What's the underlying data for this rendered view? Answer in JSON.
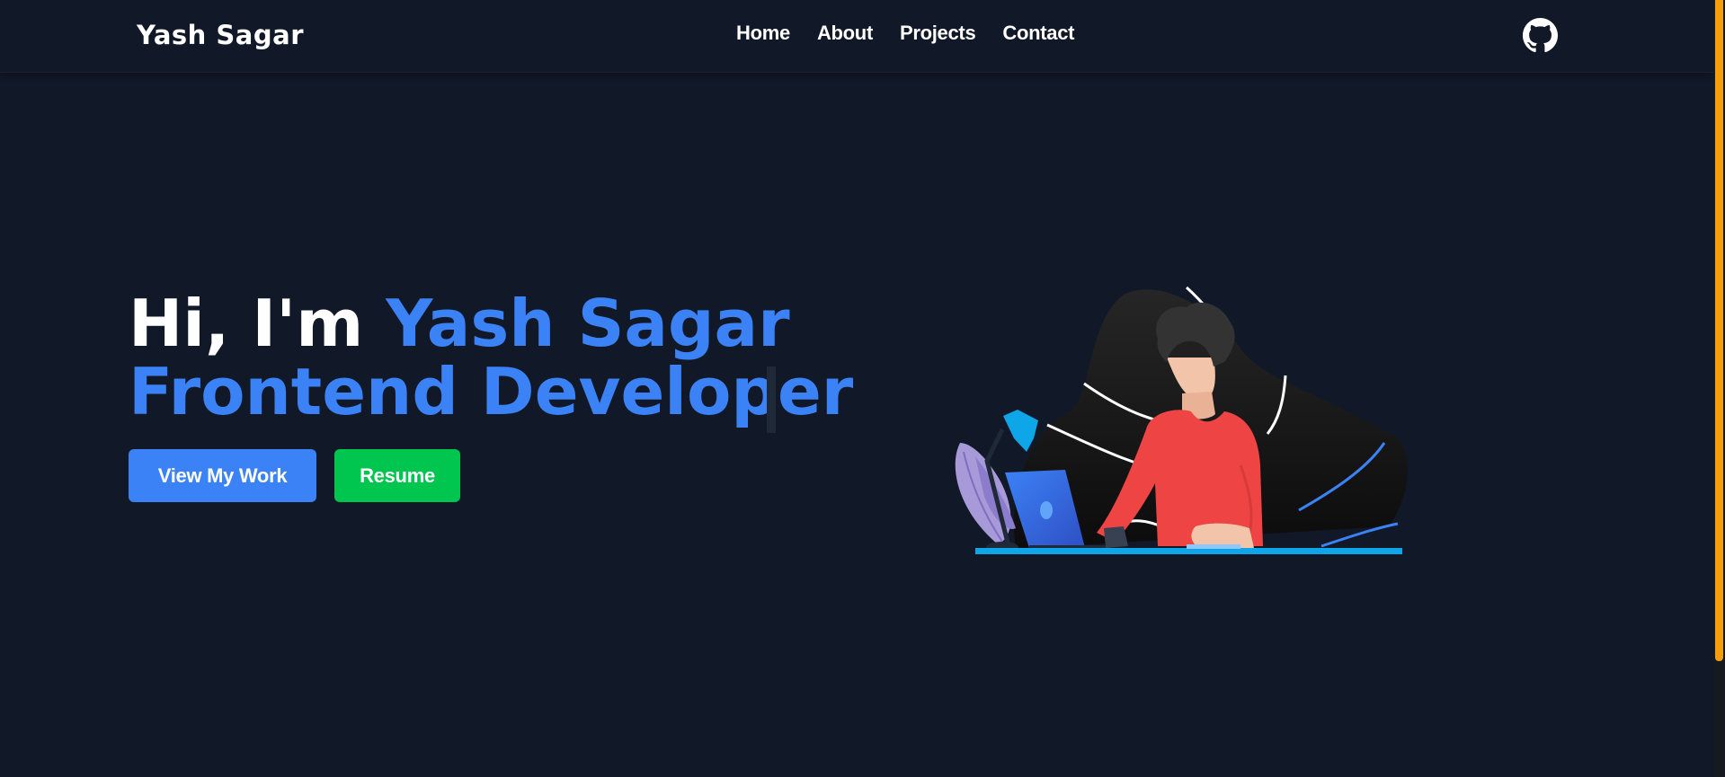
{
  "brand": {
    "name": "Yash Sagar"
  },
  "nav": {
    "links": [
      {
        "label": "Home"
      },
      {
        "label": "About"
      },
      {
        "label": "Projects"
      },
      {
        "label": "Contact"
      }
    ],
    "github_icon": "github-icon"
  },
  "hero": {
    "greeting": "Hi, I'm ",
    "name": "Yash Sagar",
    "role": "Frontend Developer",
    "buttons": {
      "work_label": "View My Work",
      "resume_label": "Resume"
    }
  },
  "colors": {
    "background": "#111827",
    "accent_blue": "#3b82f6",
    "resume_green": "#00c64f",
    "scrollbar_thumb": "#f59e0b"
  }
}
